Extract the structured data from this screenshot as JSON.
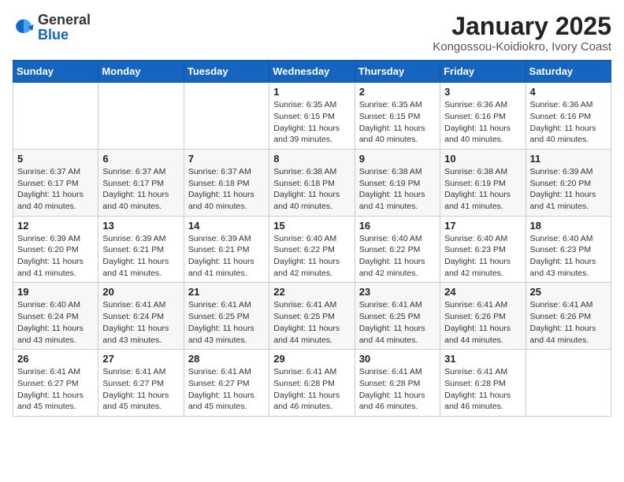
{
  "logo": {
    "text_general": "General",
    "text_blue": "Blue"
  },
  "header": {
    "title": "January 2025",
    "subtitle": "Kongossou-Koidiokro, Ivory Coast"
  },
  "weekdays": [
    "Sunday",
    "Monday",
    "Tuesday",
    "Wednesday",
    "Thursday",
    "Friday",
    "Saturday"
  ],
  "weeks": [
    [
      {
        "day": "",
        "info": ""
      },
      {
        "day": "",
        "info": ""
      },
      {
        "day": "",
        "info": ""
      },
      {
        "day": "1",
        "info": "Sunrise: 6:35 AM\nSunset: 6:15 PM\nDaylight: 11 hours\nand 39 minutes."
      },
      {
        "day": "2",
        "info": "Sunrise: 6:35 AM\nSunset: 6:15 PM\nDaylight: 11 hours\nand 40 minutes."
      },
      {
        "day": "3",
        "info": "Sunrise: 6:36 AM\nSunset: 6:16 PM\nDaylight: 11 hours\nand 40 minutes."
      },
      {
        "day": "4",
        "info": "Sunrise: 6:36 AM\nSunset: 6:16 PM\nDaylight: 11 hours\nand 40 minutes."
      }
    ],
    [
      {
        "day": "5",
        "info": "Sunrise: 6:37 AM\nSunset: 6:17 PM\nDaylight: 11 hours\nand 40 minutes."
      },
      {
        "day": "6",
        "info": "Sunrise: 6:37 AM\nSunset: 6:17 PM\nDaylight: 11 hours\nand 40 minutes."
      },
      {
        "day": "7",
        "info": "Sunrise: 6:37 AM\nSunset: 6:18 PM\nDaylight: 11 hours\nand 40 minutes."
      },
      {
        "day": "8",
        "info": "Sunrise: 6:38 AM\nSunset: 6:18 PM\nDaylight: 11 hours\nand 40 minutes."
      },
      {
        "day": "9",
        "info": "Sunrise: 6:38 AM\nSunset: 6:19 PM\nDaylight: 11 hours\nand 41 minutes."
      },
      {
        "day": "10",
        "info": "Sunrise: 6:38 AM\nSunset: 6:19 PM\nDaylight: 11 hours\nand 41 minutes."
      },
      {
        "day": "11",
        "info": "Sunrise: 6:39 AM\nSunset: 6:20 PM\nDaylight: 11 hours\nand 41 minutes."
      }
    ],
    [
      {
        "day": "12",
        "info": "Sunrise: 6:39 AM\nSunset: 6:20 PM\nDaylight: 11 hours\nand 41 minutes."
      },
      {
        "day": "13",
        "info": "Sunrise: 6:39 AM\nSunset: 6:21 PM\nDaylight: 11 hours\nand 41 minutes."
      },
      {
        "day": "14",
        "info": "Sunrise: 6:39 AM\nSunset: 6:21 PM\nDaylight: 11 hours\nand 41 minutes."
      },
      {
        "day": "15",
        "info": "Sunrise: 6:40 AM\nSunset: 6:22 PM\nDaylight: 11 hours\nand 42 minutes."
      },
      {
        "day": "16",
        "info": "Sunrise: 6:40 AM\nSunset: 6:22 PM\nDaylight: 11 hours\nand 42 minutes."
      },
      {
        "day": "17",
        "info": "Sunrise: 6:40 AM\nSunset: 6:23 PM\nDaylight: 11 hours\nand 42 minutes."
      },
      {
        "day": "18",
        "info": "Sunrise: 6:40 AM\nSunset: 6:23 PM\nDaylight: 11 hours\nand 43 minutes."
      }
    ],
    [
      {
        "day": "19",
        "info": "Sunrise: 6:40 AM\nSunset: 6:24 PM\nDaylight: 11 hours\nand 43 minutes."
      },
      {
        "day": "20",
        "info": "Sunrise: 6:41 AM\nSunset: 6:24 PM\nDaylight: 11 hours\nand 43 minutes."
      },
      {
        "day": "21",
        "info": "Sunrise: 6:41 AM\nSunset: 6:25 PM\nDaylight: 11 hours\nand 43 minutes."
      },
      {
        "day": "22",
        "info": "Sunrise: 6:41 AM\nSunset: 6:25 PM\nDaylight: 11 hours\nand 44 minutes."
      },
      {
        "day": "23",
        "info": "Sunrise: 6:41 AM\nSunset: 6:25 PM\nDaylight: 11 hours\nand 44 minutes."
      },
      {
        "day": "24",
        "info": "Sunrise: 6:41 AM\nSunset: 6:26 PM\nDaylight: 11 hours\nand 44 minutes."
      },
      {
        "day": "25",
        "info": "Sunrise: 6:41 AM\nSunset: 6:26 PM\nDaylight: 11 hours\nand 44 minutes."
      }
    ],
    [
      {
        "day": "26",
        "info": "Sunrise: 6:41 AM\nSunset: 6:27 PM\nDaylight: 11 hours\nand 45 minutes."
      },
      {
        "day": "27",
        "info": "Sunrise: 6:41 AM\nSunset: 6:27 PM\nDaylight: 11 hours\nand 45 minutes."
      },
      {
        "day": "28",
        "info": "Sunrise: 6:41 AM\nSunset: 6:27 PM\nDaylight: 11 hours\nand 45 minutes."
      },
      {
        "day": "29",
        "info": "Sunrise: 6:41 AM\nSunset: 6:28 PM\nDaylight: 11 hours\nand 46 minutes."
      },
      {
        "day": "30",
        "info": "Sunrise: 6:41 AM\nSunset: 6:28 PM\nDaylight: 11 hours\nand 46 minutes."
      },
      {
        "day": "31",
        "info": "Sunrise: 6:41 AM\nSunset: 6:28 PM\nDaylight: 11 hours\nand 46 minutes."
      },
      {
        "day": "",
        "info": ""
      }
    ]
  ]
}
